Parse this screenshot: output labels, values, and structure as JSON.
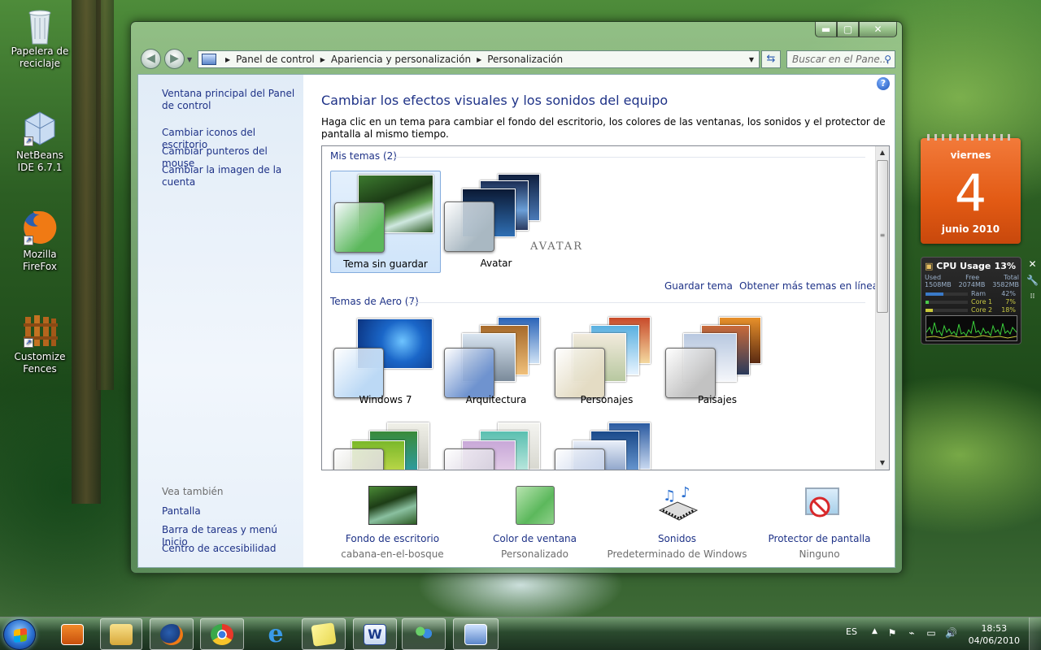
{
  "desktop": {
    "icons": [
      {
        "label": "Papelera de reciclaje",
        "icon": "recycle-bin-icon"
      },
      {
        "label": "NetBeans IDE 6.7.1",
        "icon": "netbeans-icon"
      },
      {
        "label": "Mozilla FireFox",
        "icon": "firefox-icon"
      },
      {
        "label": "Customize Fences",
        "icon": "fences-icon"
      }
    ]
  },
  "window": {
    "controls": {
      "minimize": "▬",
      "maximize": "▢",
      "close": "✕"
    },
    "breadcrumb": [
      "Panel de control",
      "Apariencia y personalización",
      "Personalización"
    ],
    "search_placeholder": "Buscar en el Pane..."
  },
  "sidebar": {
    "links": [
      "Ventana principal del Panel de control",
      "Cambiar iconos del escritorio",
      "Cambiar punteros del mouse",
      "Cambiar la imagen de la cuenta"
    ],
    "see_also_title": "Vea también",
    "see_also": [
      "Pantalla",
      "Barra de tareas y menú Inicio",
      "Centro de accesibilidad"
    ]
  },
  "main": {
    "title": "Cambiar los efectos visuales y los sonidos del equipo",
    "description": "Haga clic en un tema para cambiar el fondo del escritorio, los colores de las ventanas, los sonidos y el protector de pantalla al mismo tiempo.",
    "my_themes_header": "Mis temas (2)",
    "my_themes": [
      {
        "name": "Tema sin guardar",
        "selected": true,
        "swatch": "#5cb85c"
      },
      {
        "name": "Avatar",
        "selected": false,
        "swatch": "#a9b8c2",
        "overlay_text": "AVATAR"
      }
    ],
    "save_theme_link": "Guardar tema",
    "more_themes_link": "Obtener más temas en línea",
    "aero_header": "Temas de Aero (7)",
    "aero_themes": [
      {
        "name": "Windows 7",
        "swatch": "#bcd9f5"
      },
      {
        "name": "Arquitectura",
        "swatch": "#6f93cf"
      },
      {
        "name": "Personajes",
        "swatch": "#e4dcc4"
      },
      {
        "name": "Paisajes",
        "swatch": "#c2c2c2"
      },
      {
        "name": "",
        "swatch": "#d8d8cf"
      },
      {
        "name": "",
        "swatch": "#d6d0de"
      },
      {
        "name": "",
        "swatch": "#c7d3ea"
      }
    ],
    "bottom": [
      {
        "title": "Fondo de escritorio",
        "subtitle": "cabana-en-el-bosque",
        "icon": "desktop-background-icon"
      },
      {
        "title": "Color de ventana",
        "subtitle": "Personalizado",
        "icon": "window-color-icon"
      },
      {
        "title": "Sonidos",
        "subtitle": "Predeterminado de Windows",
        "icon": "sounds-icon"
      },
      {
        "title": "Protector de pantalla",
        "subtitle": "Ninguno",
        "icon": "screensaver-icon"
      }
    ]
  },
  "gadgets": {
    "calendar": {
      "weekday": "viernes",
      "day": "4",
      "month": "junio 2010"
    },
    "cpu": {
      "title": "CPU Usage",
      "percent": "13%",
      "labels": {
        "used": "Used",
        "free": "Free",
        "total": "Total"
      },
      "values": {
        "used": "1508MB",
        "free": "2074MB",
        "total": "3582MB"
      },
      "bars": [
        {
          "label": "Ram",
          "value": "42%",
          "fraction": 0.42
        },
        {
          "label": "Core 1",
          "value": "7%",
          "fraction": 0.07
        },
        {
          "label": "Core 2",
          "value": "18%",
          "fraction": 0.18
        }
      ]
    }
  },
  "taskbar": {
    "language": "ES",
    "time": "18:53",
    "date": "04/06/2010",
    "items": [
      {
        "icon": "media-player-icon",
        "active": false
      },
      {
        "icon": "explorer-icon",
        "active": true
      },
      {
        "icon": "firefox-icon",
        "active": true
      },
      {
        "icon": "chrome-icon",
        "active": true
      },
      {
        "icon": "internet-explorer-icon",
        "active": false
      },
      {
        "icon": "sticky-notes-icon",
        "active": true
      },
      {
        "icon": "word-icon",
        "active": true
      },
      {
        "icon": "messenger-icon",
        "active": true
      },
      {
        "icon": "control-panel-icon",
        "active": true
      }
    ]
  }
}
